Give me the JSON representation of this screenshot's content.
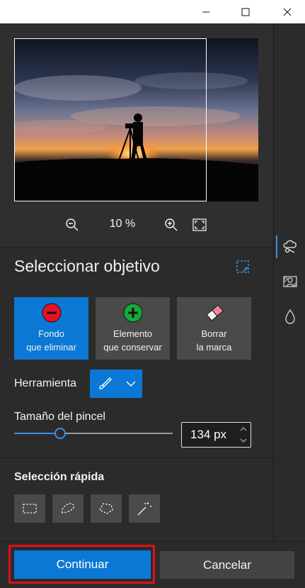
{
  "window": {
    "controls": [
      "minimize-icon",
      "maximize-icon",
      "close-icon"
    ]
  },
  "preview": {
    "zoom_text": "10 %"
  },
  "select_target": {
    "title": "Seleccionar objetivo",
    "tiles": [
      {
        "line1": "Fondo",
        "line2": "que eliminar",
        "icon": "minus-circle-icon",
        "active": true
      },
      {
        "line1": "Elemento",
        "line2": "que conservar",
        "icon": "plus-circle-icon",
        "active": false
      },
      {
        "line1": "Borrar",
        "line2": "la marca",
        "icon": "eraser-icon",
        "active": false
      }
    ],
    "tool_label": "Herramienta",
    "tool_icons": [
      "brush-icon",
      "chevron-down-icon"
    ],
    "brush_size_label": "Tamaño del pincel",
    "brush_size_value": "134 px",
    "brush_slider_fraction": 0.29
  },
  "quick_selection": {
    "title": "Selección rápida",
    "tools": [
      "rectangle-select-icon",
      "lasso-select-icon",
      "polygon-lasso-icon",
      "magic-wand-icon"
    ]
  },
  "footer": {
    "continue_label": "Continuar",
    "cancel_label": "Cancelar"
  },
  "colors": {
    "accent": "#0a78d4",
    "panel": "#2b2b2b",
    "tile": "#4a4a4a",
    "highlight": "#e0101a",
    "remove_red": "#e81123",
    "keep_green": "#16a83a"
  }
}
